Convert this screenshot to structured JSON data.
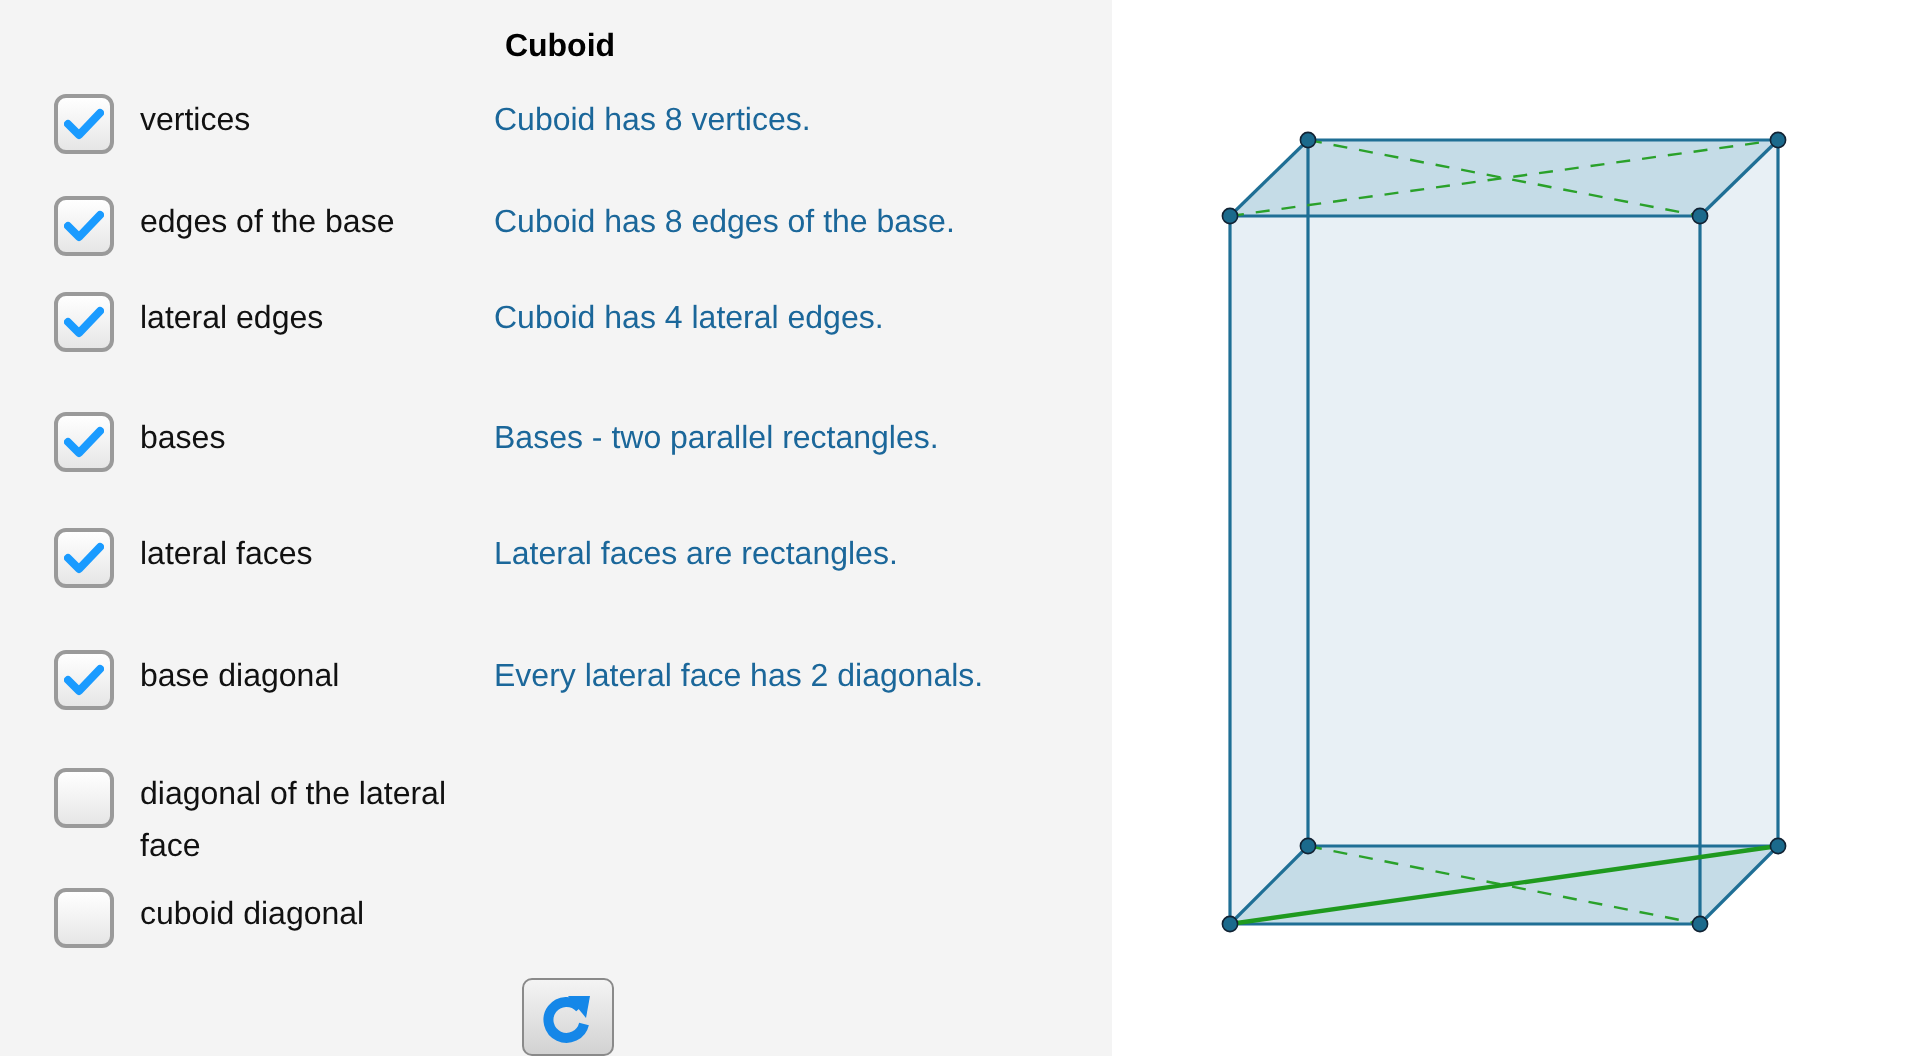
{
  "panel": {
    "title": "Cuboid",
    "options": [
      {
        "label": "vertices",
        "checked": true,
        "description": "Cuboid has 8 vertices."
      },
      {
        "label": "edges of the base",
        "checked": true,
        "description": "Cuboid has 8 edges of the base."
      },
      {
        "label": "lateral edges",
        "checked": true,
        "description": "Cuboid has 4 lateral edges."
      },
      {
        "label": "bases",
        "checked": true,
        "description": "Bases - two parallel rectangles."
      },
      {
        "label": "lateral faces",
        "checked": true,
        "description": "Lateral faces are rectangles."
      },
      {
        "label": "base diagonal",
        "checked": true,
        "description": "Every lateral face has 2 diagonals."
      },
      {
        "label": "diagonal of the lateral face",
        "checked": false
      },
      {
        "label": "cuboid diagonal",
        "checked": false
      }
    ]
  }
}
